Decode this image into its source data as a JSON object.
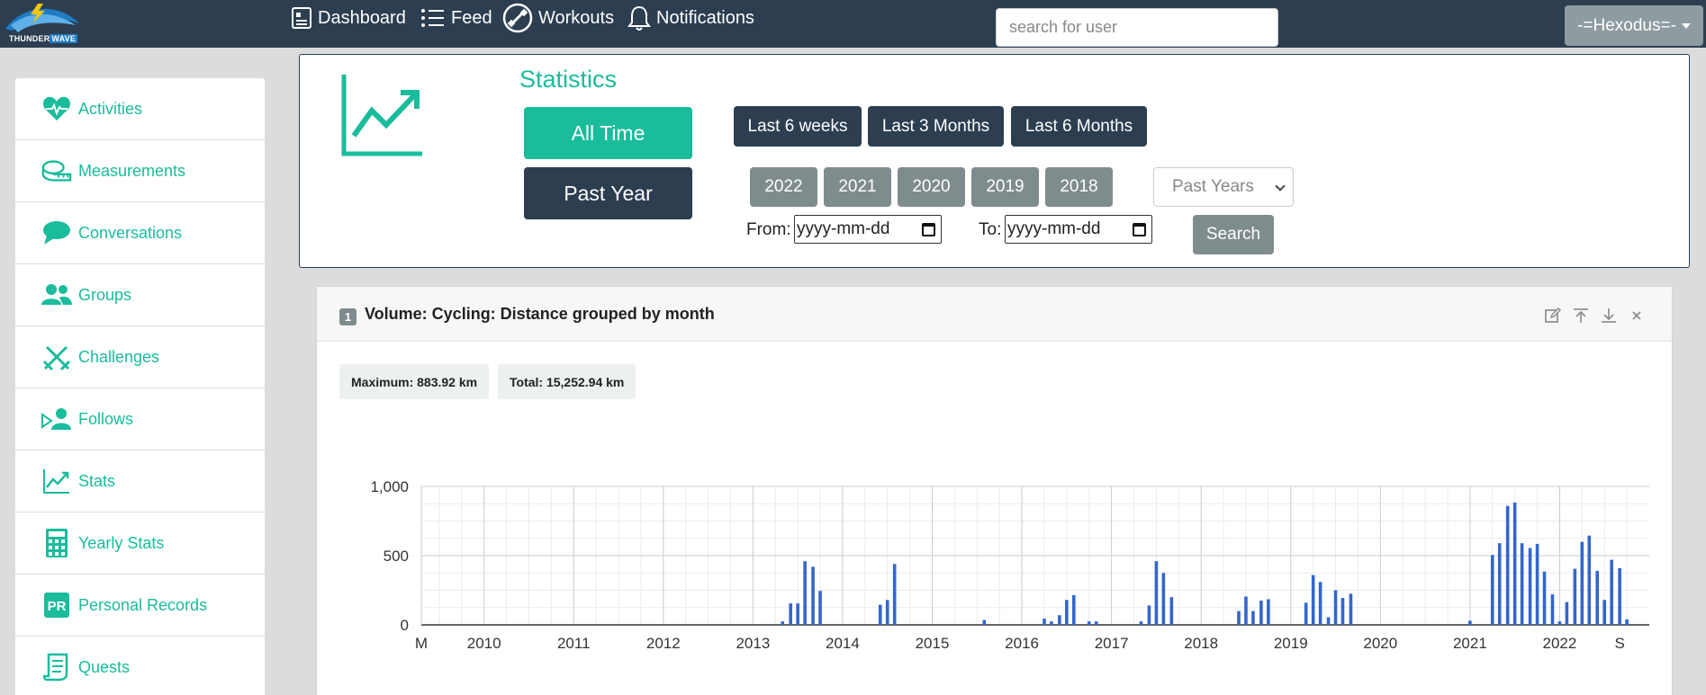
{
  "navbar": {
    "logo_text_1": "THUNDER",
    "logo_text_2": "WAVE",
    "items": [
      {
        "label": "Dashboard",
        "icon": "dashboard-icon"
      },
      {
        "label": "Feed",
        "icon": "list-icon"
      },
      {
        "label": "Workouts",
        "icon": "workouts-icon"
      },
      {
        "label": "Notifications",
        "icon": "bell-icon"
      }
    ],
    "search_placeholder": "search for user",
    "user_label": "-=Hexodus=-"
  },
  "sidebar": {
    "items": [
      {
        "label": "Activities",
        "icon": "heart-pulse-icon"
      },
      {
        "label": "Measurements",
        "icon": "tape-measure-icon"
      },
      {
        "label": "Conversations",
        "icon": "chat-bubble-icon"
      },
      {
        "label": "Groups",
        "icon": "users-icon"
      },
      {
        "label": "Challenges",
        "icon": "swords-icon"
      },
      {
        "label": "Follows",
        "icon": "follow-icon"
      },
      {
        "label": "Stats",
        "icon": "chart-line-icon"
      },
      {
        "label": "Yearly Stats",
        "icon": "calculator-icon"
      },
      {
        "label": "Personal Records",
        "icon": "pr-icon"
      },
      {
        "label": "Quests",
        "icon": "scroll-icon"
      }
    ]
  },
  "stats": {
    "title": "Statistics",
    "all_time": "All Time",
    "past_year": "Past Year",
    "ranges": [
      "Last 6 weeks",
      "Last 3 Months",
      "Last 6 Months"
    ],
    "years": [
      "2022",
      "2021",
      "2020",
      "2019",
      "2018"
    ],
    "select_value": "Past Years",
    "from_label": "From:",
    "to_label": "To:",
    "date_placeholder": "yyyy-mm-dd",
    "search_button": "Search"
  },
  "card": {
    "number": "1",
    "title": "Volume: Cycling: Distance grouped by month",
    "maximum": "Maximum: 883.92 km",
    "total": "Total: 15,252.94 km",
    "icons": [
      "edit-icon",
      "move-up-icon",
      "move-down-icon",
      "close-icon"
    ]
  },
  "chart_data": {
    "type": "bar",
    "color": "#3366cc",
    "ylim": [
      0,
      1000
    ],
    "yticks": [
      0,
      500,
      1000
    ],
    "ytick_labels": [
      "0",
      "500",
      "1,000"
    ],
    "xlim": [
      2009.3,
      2023.0
    ],
    "xtick_labels": [
      "M",
      "2010",
      "2011",
      "2012",
      "2013",
      "2014",
      "2015",
      "2016",
      "2017",
      "2018",
      "2019",
      "2020",
      "2021",
      "2022",
      "S"
    ],
    "xtick_positions": [
      2009.3,
      2010,
      2011,
      2012,
      2013,
      2014,
      2015,
      2016,
      2017,
      2018,
      2019,
      2020,
      2021,
      2022,
      2022.67
    ],
    "bars": [
      {
        "x": 2013.33,
        "y": 25
      },
      {
        "x": 2013.42,
        "y": 155
      },
      {
        "x": 2013.5,
        "y": 155
      },
      {
        "x": 2013.58,
        "y": 460
      },
      {
        "x": 2013.67,
        "y": 420
      },
      {
        "x": 2013.75,
        "y": 245
      },
      {
        "x": 2014.42,
        "y": 145
      },
      {
        "x": 2014.5,
        "y": 180
      },
      {
        "x": 2014.58,
        "y": 440
      },
      {
        "x": 2015.58,
        "y": 35
      },
      {
        "x": 2016.25,
        "y": 45
      },
      {
        "x": 2016.33,
        "y": 25
      },
      {
        "x": 2016.42,
        "y": 70
      },
      {
        "x": 2016.5,
        "y": 180
      },
      {
        "x": 2016.58,
        "y": 215
      },
      {
        "x": 2016.75,
        "y": 25
      },
      {
        "x": 2016.83,
        "y": 25
      },
      {
        "x": 2017.33,
        "y": 25
      },
      {
        "x": 2017.42,
        "y": 140
      },
      {
        "x": 2017.5,
        "y": 460
      },
      {
        "x": 2017.58,
        "y": 375
      },
      {
        "x": 2017.67,
        "y": 200
      },
      {
        "x": 2018.42,
        "y": 100
      },
      {
        "x": 2018.5,
        "y": 205
      },
      {
        "x": 2018.58,
        "y": 100
      },
      {
        "x": 2018.67,
        "y": 175
      },
      {
        "x": 2018.75,
        "y": 185
      },
      {
        "x": 2019.17,
        "y": 160
      },
      {
        "x": 2019.25,
        "y": 360
      },
      {
        "x": 2019.33,
        "y": 310
      },
      {
        "x": 2019.42,
        "y": 55
      },
      {
        "x": 2019.5,
        "y": 250
      },
      {
        "x": 2019.58,
        "y": 195
      },
      {
        "x": 2019.67,
        "y": 225
      },
      {
        "x": 2021.0,
        "y": 30
      },
      {
        "x": 2021.25,
        "y": 505
      },
      {
        "x": 2021.33,
        "y": 590
      },
      {
        "x": 2021.42,
        "y": 860
      },
      {
        "x": 2021.5,
        "y": 884
      },
      {
        "x": 2021.58,
        "y": 590
      },
      {
        "x": 2021.67,
        "y": 555
      },
      {
        "x": 2021.75,
        "y": 585
      },
      {
        "x": 2021.83,
        "y": 385
      },
      {
        "x": 2021.92,
        "y": 220
      },
      {
        "x": 2022.0,
        "y": 25
      },
      {
        "x": 2022.08,
        "y": 165
      },
      {
        "x": 2022.17,
        "y": 405
      },
      {
        "x": 2022.25,
        "y": 600
      },
      {
        "x": 2022.33,
        "y": 645
      },
      {
        "x": 2022.42,
        "y": 390
      },
      {
        "x": 2022.5,
        "y": 180
      },
      {
        "x": 2022.58,
        "y": 470
      },
      {
        "x": 2022.67,
        "y": 410
      },
      {
        "x": 2022.75,
        "y": 40
      }
    ]
  }
}
